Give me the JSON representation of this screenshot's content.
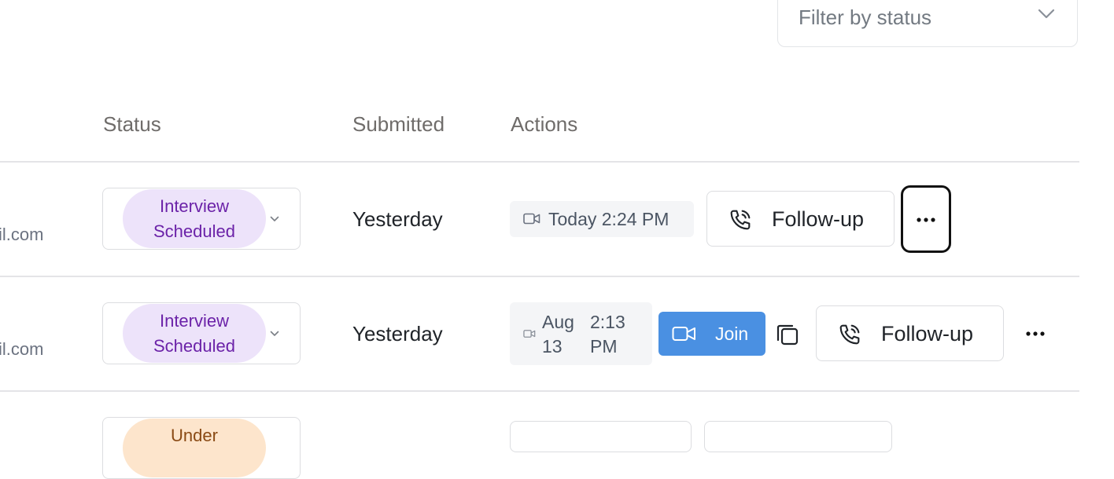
{
  "filter": {
    "placeholder": "Filter by status"
  },
  "table": {
    "headers": {
      "status": "Status",
      "submitted": "Submitted",
      "actions": "Actions"
    },
    "rows": [
      {
        "email": "il.com",
        "status": "Interview Scheduled",
        "submitted": "Yesterday",
        "meeting_time": "Today 2:24 PM",
        "follow_up": "Follow-up"
      },
      {
        "email": "il.com",
        "status": "Interview Scheduled",
        "submitted": "Yesterday",
        "meeting_date": "Aug 13",
        "meeting_time": "2:13 PM",
        "join": "Join",
        "follow_up": "Follow-up"
      },
      {
        "status": "Under"
      }
    ]
  },
  "colors": {
    "interview_pill_bg": "#ede3fa",
    "interview_pill_text": "#6b22a8",
    "under_pill_bg": "#fde5cc",
    "join_button": "#4a90e2"
  },
  "icons": [
    "chevron-down-icon",
    "video-icon",
    "phone-icon",
    "copy-icon",
    "more-dots-icon"
  ]
}
